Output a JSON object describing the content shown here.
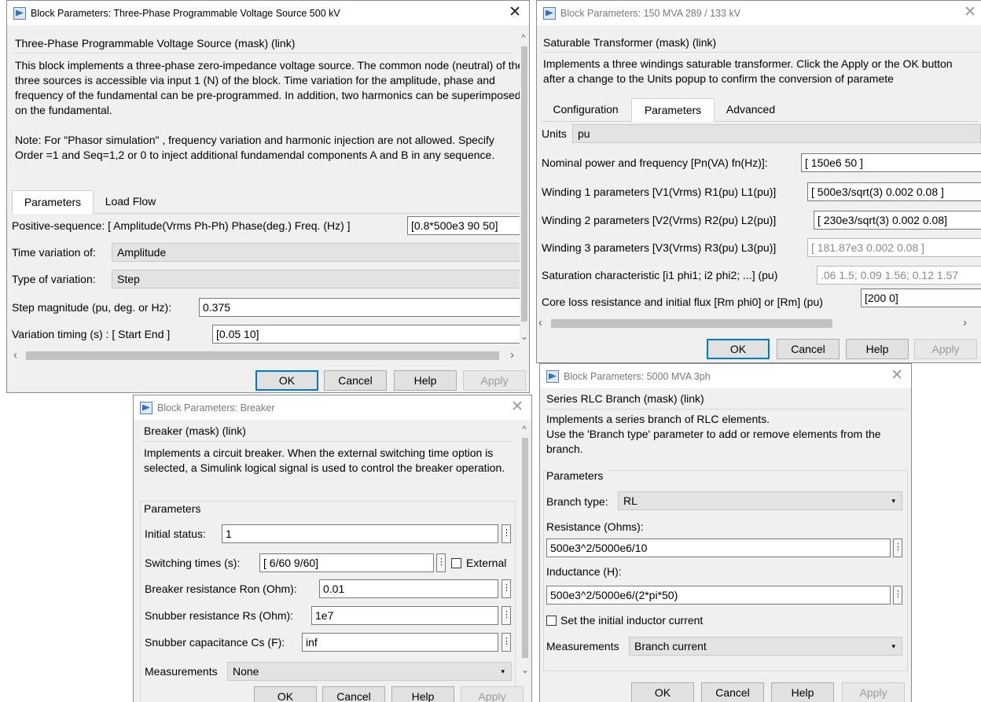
{
  "win1": {
    "title": "Block Parameters: Three-Phase Programmable Voltage Source 500 kV",
    "close": "✕",
    "mask_title": "Three-Phase Programmable Voltage Source (mask) (link)",
    "desc": "This block implements a three-phase zero-impedance voltage source. The common node (neutral) of the three sources is accessible via input 1 (N) of the block. Time variation for the amplitude, phase and frequency of the fundamental can be pre-programmed. In addition, two harmonics can be superimposed on the fundamental.",
    "note": "Note: For  \"Phasor simulation\" , frequency variation and harmonic injection are not allowed. Specify  Order =1 and Seq=1,2 or 0 to inject additional fundamendal components A and B in any sequence.",
    "tabs": [
      "Parameters",
      "Load Flow"
    ],
    "pos_seq_label": "Positive-sequence: [ Amplitude(Vrms Ph-Ph)  Phase(deg.)   Freq. (Hz) ]",
    "pos_seq_value": "[0.8*500e3  90  50]",
    "time_var_label": "Time variation of:",
    "time_var_value": "Amplitude",
    "type_var_label": "Type of variation:",
    "type_var_value": "Step",
    "step_mag_label": "Step magnitude (pu, deg. or Hz):",
    "step_mag_value": "0.375",
    "var_timing_label": "Variation timing (s) : [ Start   End ]",
    "var_timing_value": "[0.05 10]",
    "buttons": {
      "ok": "OK",
      "cancel": "Cancel",
      "help": "Help",
      "apply": "Apply"
    }
  },
  "win2": {
    "title": "Block Parameters: 150 MVA 289 / 133 kV",
    "close": "✕",
    "mask_title": "Saturable Transformer (mask) (link)",
    "desc": "Implements a three windings saturable transformer. Click the Apply or the OK button after a change to the Units popup to confirm the conversion of paramete",
    "tabs": [
      "Configuration",
      "Parameters",
      "Advanced"
    ],
    "units_label": "Units",
    "units_value": "pu",
    "nominal_label": "Nominal power and frequency [Pn(VA) fn(Hz)]:",
    "nominal_value": "[ 150e6 50 ]",
    "w1_label": "Winding 1 parameters [V1(Vrms) R1(pu) L1(pu)]",
    "w1_value": "[ 500e3/sqrt(3) 0.002 0.08 ]",
    "w2_label": "Winding 2 parameters [V2(Vrms) R2(pu) L2(pu)]",
    "w2_value": "[ 230e3/sqrt(3) 0.002 0.08]",
    "w3_label": "Winding 3 parameters [V3(Vrms) R3(pu) L3(pu)]",
    "w3_value": "[ 181.87e3  0.002  0.08 ]",
    "sat_label": "Saturation characteristic [i1 phi1; i2 phi2; ...] (pu)",
    "sat_value": ".06 1.5; 0.09 1.56; 0.12 1.57",
    "core_label": "Core loss resistance and initial flux [Rm phi0] or [Rm] (pu)",
    "core_value": "[200 0]",
    "buttons": {
      "ok": "OK",
      "cancel": "Cancel",
      "help": "Help",
      "apply": "Apply"
    }
  },
  "win3": {
    "title": "Block Parameters: Breaker",
    "close": "✕",
    "mask_title": "Breaker (mask) (link)",
    "desc": "Implements a circuit breaker. When the external switching time option is selected, a Simulink logical signal is used to control the breaker operation.",
    "group_label": "Parameters",
    "init_label": "Initial status:",
    "init_value": "1",
    "sw_label": "Switching times (s):",
    "sw_value": "[ 6/60  9/60]",
    "external_label": "External",
    "ron_label": "Breaker resistance Ron (Ohm):",
    "ron_value": "0.01",
    "rs_label": "Snubber resistance Rs (Ohm):",
    "rs_value": "1e7",
    "cs_label": "Snubber capacitance Cs (F):",
    "cs_value": "inf",
    "meas_label": "Measurements",
    "meas_value": "None",
    "dots": "⋮",
    "buttons": {
      "ok": "OK",
      "cancel": "Cancel",
      "help": "Help",
      "apply": "Apply"
    }
  },
  "win4": {
    "title": "Block Parameters: 5000 MVA 3ph",
    "close": "✕",
    "mask_title": "Series RLC Branch (mask) (link)",
    "desc": "Implements a series branch of RLC elements.\nUse the 'Branch type' parameter to add or remove elements from the branch.",
    "group_label": "Parameters",
    "branch_label": "Branch type:",
    "branch_value": "RL",
    "res_label": "Resistance (Ohms):",
    "res_value": "500e3^2/5000e6/10",
    "ind_label": "Inductance (H):",
    "ind_value": "500e3^2/5000e6/(2*pi*50)",
    "set_init_label": "Set the initial inductor current",
    "meas_label": "Measurements",
    "meas_value": "Branch current",
    "dots": "⋮",
    "buttons": {
      "ok": "OK",
      "cancel": "Cancel",
      "help": "Help",
      "apply": "Apply"
    }
  },
  "glyphs": {
    "up": "^",
    "down": "⌄",
    "left": "‹",
    "right": "›",
    "caret": "▾"
  }
}
